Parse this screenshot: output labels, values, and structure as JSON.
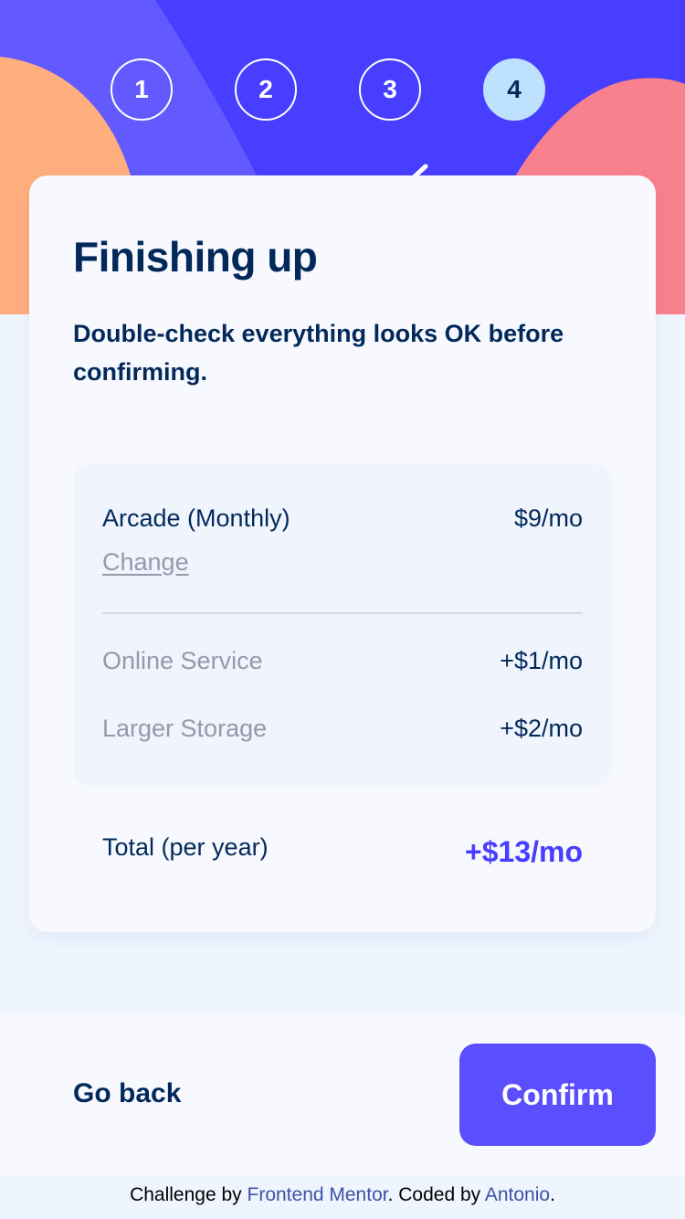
{
  "steps": [
    "1",
    "2",
    "3",
    "4"
  ],
  "active_step": 4,
  "heading": {
    "title": "Finishing up",
    "subtitle": "Double-check everything looks OK before confirming."
  },
  "summary": {
    "plan_name": "Arcade (Monthly)",
    "plan_price": "$9/mo",
    "change_label": "Change",
    "addons": [
      {
        "name": "Online Service",
        "price": "+$1/mo"
      },
      {
        "name": "Larger Storage",
        "price": "+$2/mo"
      }
    ],
    "total_label": "Total (per year)",
    "total_price": "+$13/mo"
  },
  "actions": {
    "back_label": "Go back",
    "confirm_label": "Confirm"
  },
  "attribution": {
    "prefix": "Challenge by ",
    "link1": "Frontend Mentor",
    "middle": ". Coded by ",
    "link2": "Antonio",
    "suffix": "."
  },
  "colors": {
    "marine_blue": "#02295a",
    "purplish_blue": "#483eff",
    "confirm_button": "#5b4eff",
    "light_blue": "#bee2fd",
    "cool_gray": "#9699ab",
    "alabaster": "#f8f9ff",
    "magnolia": "#eff5ff",
    "orange_blob": "#ffaf7e",
    "pink_blob": "#f9818e"
  }
}
